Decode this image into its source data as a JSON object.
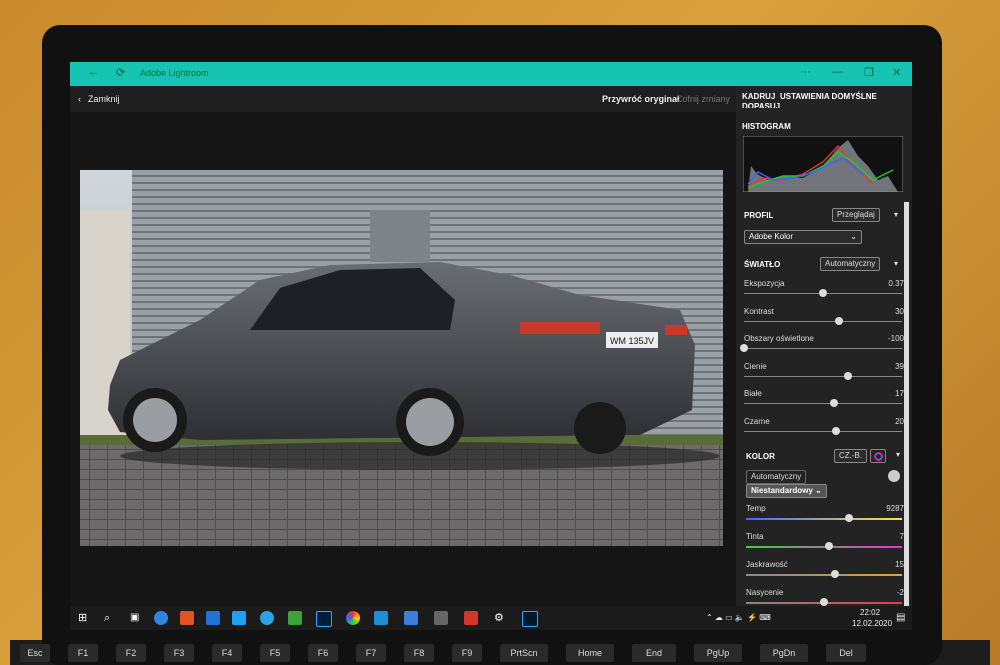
{
  "window": {
    "title": "Adobe Lightroom",
    "controls": [
      "···",
      "—",
      "❐",
      "✕"
    ]
  },
  "toolbar": {
    "close": "Zamknij",
    "restore": "Przywróć oryginał",
    "undo": "Cofnij zmiany"
  },
  "panel": {
    "tabs": [
      "KADRUJ",
      "USTAWIENIA DOMYŚLNE",
      "DOPASUJ"
    ],
    "histogram": "HISTOGRAM",
    "profile": {
      "title": "PROFIL",
      "browse": "Przeglądaj",
      "selected": "Adobe Kolor"
    },
    "light": {
      "title": "ŚWIATŁO",
      "auto": "Automatyczny",
      "sliders": [
        {
          "label": "Ekspozycja",
          "value": "0.37",
          "pos": 0.5
        },
        {
          "label": "Kontrast",
          "value": "30",
          "pos": 0.6
        },
        {
          "label": "Obszary oświetlone",
          "value": "-100",
          "pos": 0.0
        },
        {
          "label": "Cienie",
          "value": "39",
          "pos": 0.66
        },
        {
          "label": "Białe",
          "value": "17",
          "pos": 0.57
        },
        {
          "label": "Czarne",
          "value": "20",
          "pos": 0.58
        }
      ]
    },
    "color": {
      "title": "KOLOR",
      "bw": "CZ.-B.",
      "auto": "Automatyczny",
      "preset": "Niestandardowy",
      "sliders": [
        {
          "label": "Temp",
          "value": "9287",
          "pos": 0.66
        },
        {
          "label": "Tinta",
          "value": "7",
          "pos": 0.53
        },
        {
          "label": "Jaskrawość",
          "value": "15",
          "pos": 0.57
        },
        {
          "label": "Nasycenie",
          "value": "-2",
          "pos": 0.5
        }
      ]
    }
  },
  "taskbar": {
    "time": "22:02",
    "date": "12.02.2020"
  },
  "keyboard": [
    "Esc",
    "F1",
    "F2",
    "F3",
    "F4",
    "F5",
    "F6",
    "F7",
    "F8",
    "F9",
    "PrtScn",
    "Home",
    "End",
    "PgUp",
    "PgDn",
    "Del"
  ],
  "plate": "WM 135JV"
}
